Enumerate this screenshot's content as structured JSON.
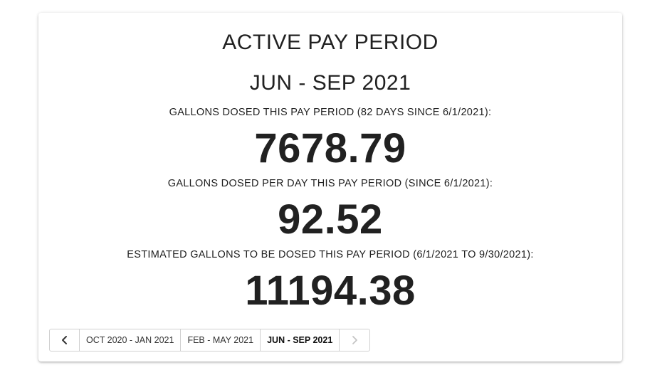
{
  "card": {
    "title": "ACTIVE PAY PERIOD",
    "period": "JUN - SEP 2021",
    "metrics": [
      {
        "label": "GALLONS DOSED THIS PAY PERIOD (82 DAYS SINCE 6/1/2021):",
        "value": "7678.79"
      },
      {
        "label": "GALLONS DOSED PER DAY THIS PAY PERIOD (SINCE 6/1/2021):",
        "value": "92.52"
      },
      {
        "label": "ESTIMATED GALLONS TO BE DOSED THIS PAY PERIOD (6/1/2021 TO 9/30/2021):",
        "value": "11194.38"
      }
    ]
  },
  "pager": {
    "prev_icon": "chevron-left-icon",
    "next_icon": "chevron-right-icon",
    "periods": [
      {
        "label": "OCT 2020 - JAN 2021",
        "active": false
      },
      {
        "label": "FEB - MAY 2021",
        "active": false
      },
      {
        "label": "JUN - SEP 2021",
        "active": true
      }
    ],
    "next_disabled": true
  }
}
